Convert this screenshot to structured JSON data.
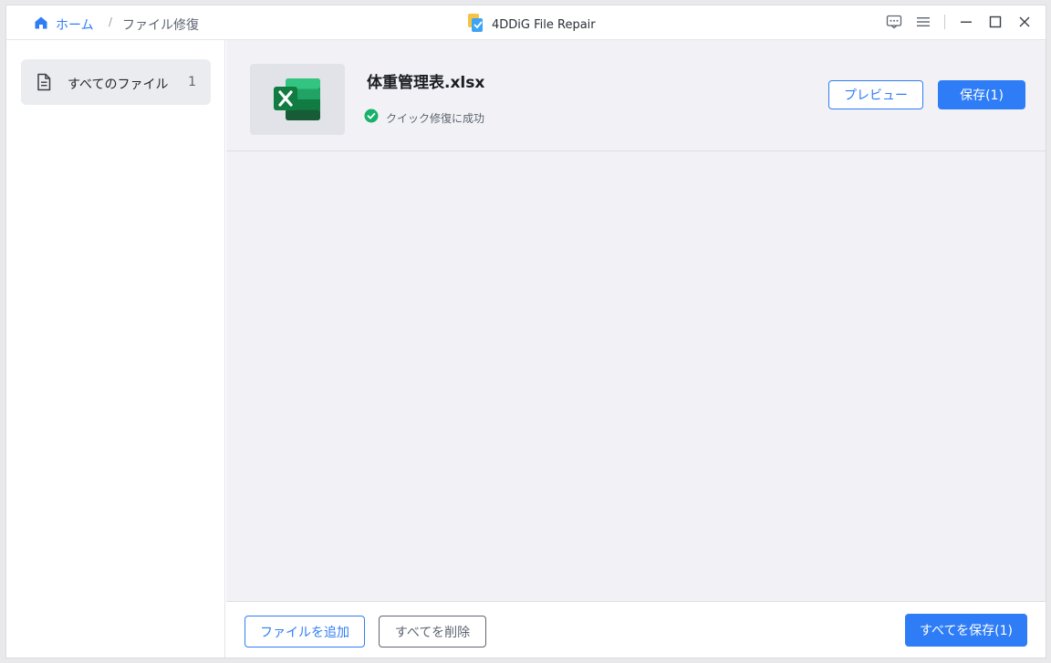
{
  "breadcrumb": {
    "home": "ホーム",
    "separator": "/",
    "current": "ファイル修復"
  },
  "app": {
    "title": "4DDiG File Repair"
  },
  "window_controls": {
    "feedback": "feedback-icon",
    "menu": "menu-icon",
    "minimize": "minimize-icon",
    "maximize": "maximize-icon",
    "close": "close-icon"
  },
  "sidebar": {
    "items": [
      {
        "label": "すべてのファイル",
        "count": "1",
        "icon": "document-icon"
      }
    ]
  },
  "file": {
    "name": "体重管理表.xlsx",
    "status": "クイック修復に成功",
    "icon": "excel-icon",
    "preview_label": "プレビュー",
    "save_label": "保存(1)"
  },
  "footer": {
    "add_label": "ファイルを追加",
    "delete_all_label": "すべてを削除",
    "save_all_label": "すべてを保存(1)"
  },
  "colors": {
    "accent": "#2f7df6",
    "success": "#17b26a",
    "excel_green": "#1d8a4e"
  }
}
